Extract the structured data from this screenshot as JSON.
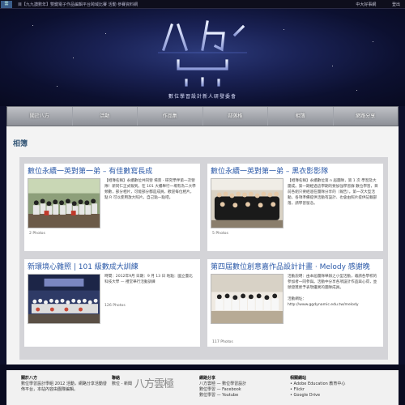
{
  "topbar": {
    "logo": "雲",
    "marquee": "目【九九讚數年】雙鍵電子作品編輯平台跨域比賽 活動 參賽資料網",
    "links": [
      "中大好事網",
      "登出"
    ]
  },
  "banner": {
    "subtitle": "數位學習設計新人研發委會"
  },
  "nav": [
    "關於八方",
    "活動",
    "作品集",
    "部落格",
    "相簿",
    "網路分享"
  ],
  "page_title": "相簿",
  "albums": [
    {
      "title": "數位永續一英對第一弟 – 有佳數寫長成",
      "desc": "【相簿名稱】永續數位共同營  場景 - 研究學伴第一次營隊！新同仁正式報到。在 101 大樓舉行一場有為二大學頻數，部分相片，可能部分都是成員，歡迎每位相片，點 R 可以使用放大照片，自己點一點吧。",
      "count": "2 Photos"
    },
    {
      "title": "數位永續一英對第一弟 – 黑衣影影隊",
      "desc": "【相簿名稱】永續數位第 n 屆團隊，第 1 次 學習及大團成。第一期經過這學期的要加強學習群  數位學習，目前各組只要經過在團隊分享的（報告）。第一次大型活動，各項準備提供活動有設計、也會由照片提供記載部落，請學習留念。",
      "count": "5 Photos"
    },
    {
      "title": "新環境心雜照 | 101 級數成大訓練",
      "desc": "時間：2012年9月 日期：9 月 13 日 地點：國立臺北科技大學 — 禮堂舉行活動訓練",
      "count": "126 Photos"
    },
    {
      "title": "第四屆數位創意嘉作品設計計畫 · Melody 感謝晚",
      "desc": "活動說明：由本屆團隊舉辦之小型活動，邀請各學校的參加者一同參與。活動中分享各項設計作品與心得，並頒發獎狀予表現優異的團隊成員。\n\n活動網址：\nhttp://www.ggdynamic.edu.tw/melody",
      "count": "117 Photos"
    }
  ],
  "footer": {
    "col1": {
      "heading": "關於八方",
      "text": "數位學習設計學組 2012 活動，網路分享活動發佈平台，本站內容由團隊編輯。"
    },
    "col2": {
      "heading": "聯絡",
      "text": "數位 - 新聞"
    },
    "logo_text": "八方雲極",
    "col3": {
      "heading": "網路分享",
      "lines": [
        "八方雲極 — 數位學習設計",
        "數位學習 — Facebook",
        "數位學習 — Youtube"
      ]
    },
    "col4": {
      "heading": "相關網站",
      "lines": [
        "• Adobe Education 教育中心",
        "• Flickr",
        "• Google Drive"
      ]
    }
  },
  "colors": {
    "accent": "#2c5aa8",
    "banner_dark": "#0c1030",
    "nav_gray": "#9ea1a8"
  }
}
